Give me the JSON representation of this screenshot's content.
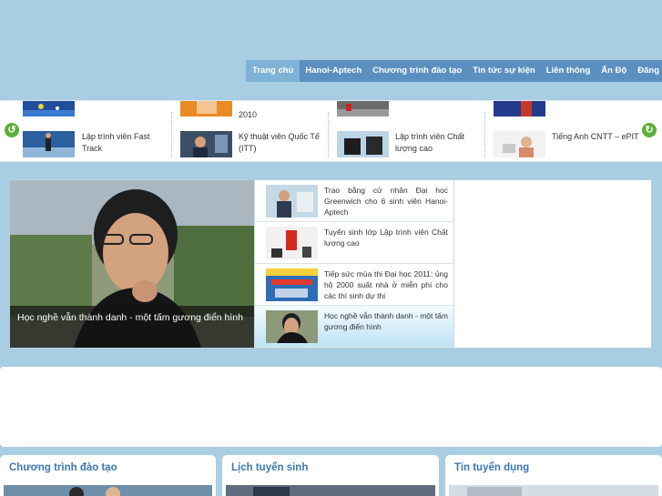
{
  "nav": {
    "items": [
      {
        "label": "Trang chủ",
        "active": true
      },
      {
        "label": "Hanoi-Aptech",
        "active": false
      },
      {
        "label": "Chương trình đào tạo",
        "active": false
      },
      {
        "label": "Tin tức sự kiện",
        "active": false
      },
      {
        "label": "Liên thông",
        "active": false
      },
      {
        "label": "Ấn Độ",
        "active": false
      },
      {
        "label": "Đăng ký học",
        "active": false
      }
    ]
  },
  "programs": {
    "items": [
      {
        "label": "Lập trình viên Fast Track",
        "icon": "fast-track-thumb"
      },
      {
        "label": "Kỹ thuật viên Quốc Tế (ITT)",
        "icon": "itt-thumb",
        "top_label": "2010"
      },
      {
        "label": "Lập trình viên Chất lượng cao",
        "icon": "quality-thumb"
      },
      {
        "label": "Tiếng Anh CNTT – ePIT",
        "icon": "epit-thumb"
      }
    ]
  },
  "featured": {
    "hero_caption": "Học nghề vẫn thành danh - một tấm gương điển hình",
    "news": [
      {
        "text": "Trao bằng cử nhân Đại học Greenwich cho 6 sinh viên Hanoi-Aptech",
        "active": false
      },
      {
        "text": "Tuyển sinh lớp Lập trình viên Chất lượng cao",
        "active": false
      },
      {
        "text": "Tiếp sức mùa thi Đại học 2011: ủng hộ 2000 suất nhà ở miễn phí cho các thí sinh dự thi",
        "active": false
      },
      {
        "text": "Học nghề vẫn thành danh - một tấm gương điển hình",
        "active": true
      }
    ]
  },
  "boxes": [
    {
      "title": "Chương trình đào tạo"
    },
    {
      "title": "Lịch tuyển sinh"
    },
    {
      "title": "Tin tuyển dụng"
    }
  ],
  "colors": {
    "nav_bg": "#5b8fc0",
    "nav_active": "#7eb2d6",
    "page_bg": "#a9cde2",
    "box_title": "#3b77b0"
  }
}
